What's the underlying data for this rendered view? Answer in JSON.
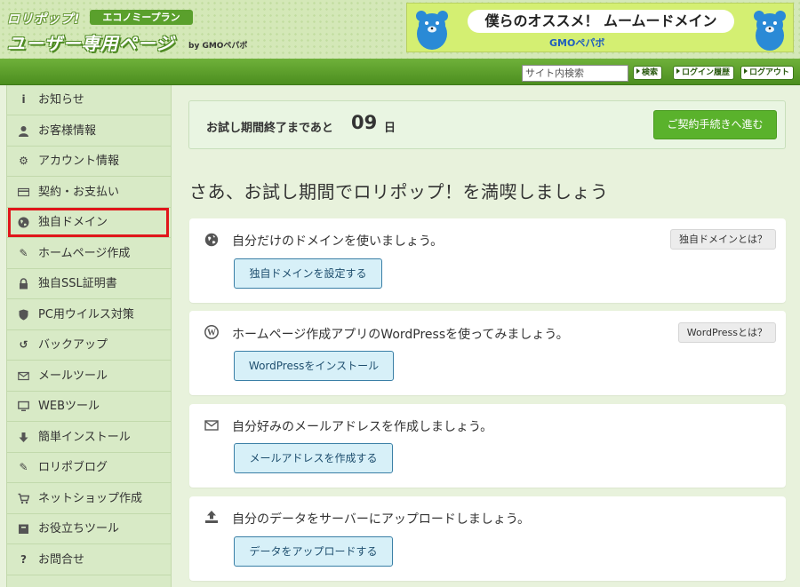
{
  "header": {
    "logo_small": "ロリポップ!",
    "plan_badge": "エコノミープラン",
    "logo_main": "ユーザー専用ページ",
    "logo_by": "by GMOペパボ",
    "banner_text": "僕らのオススメ！ ムームードメイン",
    "banner_brand": "GMOペパボ"
  },
  "navbar": {
    "search_placeholder": "サイト内検索",
    "search_button": "検索",
    "login_history": "ログイン履歴",
    "logout": "ログアウト"
  },
  "sidebar": {
    "items": [
      {
        "label": "お知らせ",
        "icon": "info-icon",
        "glyph": "i"
      },
      {
        "label": "お客様情報",
        "icon": "user-icon",
        "glyph": "👤"
      },
      {
        "label": "アカウント情報",
        "icon": "gear-icon",
        "glyph": "⚙"
      },
      {
        "label": "契約・お支払い",
        "icon": "credit-card-icon",
        "glyph": "▭"
      },
      {
        "label": "独自ドメイン",
        "icon": "globe-icon",
        "glyph": "●"
      },
      {
        "label": "ホームページ作成",
        "icon": "edit-icon",
        "glyph": "✎"
      },
      {
        "label": "独自SSL証明書",
        "icon": "lock-icon",
        "glyph": "🔒"
      },
      {
        "label": "PC用ウイルス対策",
        "icon": "shield-icon",
        "glyph": "⛉"
      },
      {
        "label": "バックアップ",
        "icon": "history-icon",
        "glyph": "↺"
      },
      {
        "label": "メールツール",
        "icon": "envelope-icon",
        "glyph": "✉"
      },
      {
        "label": "WEBツール",
        "icon": "monitor-icon",
        "glyph": "▭"
      },
      {
        "label": "簡単インストール",
        "icon": "download-arrow-icon",
        "glyph": "↓"
      },
      {
        "label": "ロリポブログ",
        "icon": "pencil-icon",
        "glyph": "✎"
      },
      {
        "label": "ネットショップ作成",
        "icon": "cart-icon",
        "glyph": "🛒"
      },
      {
        "label": "お役立ちツール",
        "icon": "box-icon",
        "glyph": "▦"
      },
      {
        "label": "お問合せ",
        "icon": "question-icon",
        "glyph": "?"
      }
    ]
  },
  "trial": {
    "text": "お試し期間終了まであと",
    "days": "09",
    "unit": "日",
    "contract_button": "ご契約手続きへ進む"
  },
  "headline": "さあ、お試し期間でロリポップ！を満喫しましょう",
  "cards": [
    {
      "icon": "globe-icon",
      "text": "自分だけのドメインを使いましょう。",
      "button": "独自ドメインを設定する",
      "help": "独自ドメインとは？"
    },
    {
      "icon": "wordpress-icon",
      "text": "ホームページ作成アプリのWordPressを使ってみましょう。",
      "button": "WordPressをインストール",
      "help": "WordPressとは？"
    },
    {
      "icon": "envelope-icon",
      "text": "自分好みのメールアドレスを作成しましょう。",
      "button": "メールアドレスを作成する"
    },
    {
      "icon": "upload-icon",
      "text": "自分のデータをサーバーにアップロードしましょう。",
      "button": "データをアップロードする"
    }
  ],
  "colors": {
    "accent_green": "#5ab22c",
    "highlight_red": "#e0161b",
    "button_blue_bg": "#d7f0f8",
    "button_blue_border": "#3a7fa6"
  }
}
